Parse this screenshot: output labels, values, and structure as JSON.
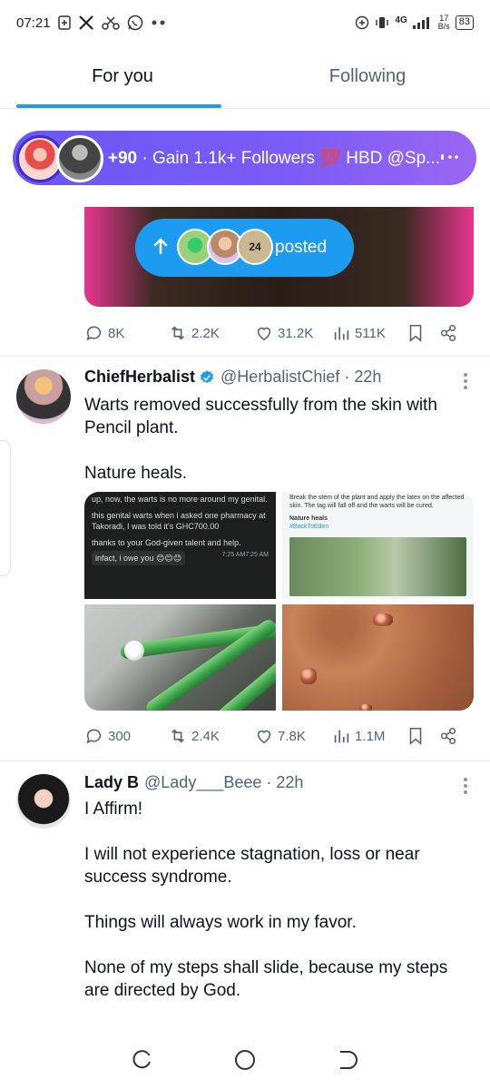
{
  "status_bar": {
    "time": "07:21",
    "network": "4G",
    "speed_value": "17",
    "speed_unit": "B/s",
    "battery": "83",
    "icons": [
      "add-box-icon",
      "x-logo-icon",
      "scissors-icon",
      "whatsapp-icon",
      "more-dots-icon",
      "data-saver-icon",
      "vibrate-icon",
      "signal-icon",
      "battery-icon"
    ]
  },
  "tabs": [
    {
      "label": "For you",
      "active": true
    },
    {
      "label": "Following",
      "active": false
    }
  ],
  "space_banner": {
    "count": "+90",
    "separator": " · ",
    "title": "Gain 1.1k+ Followers 💯 HBD @Sp...",
    "colors": {
      "start": "#6b56f5",
      "end": "#9a66f2"
    }
  },
  "posted_pill": {
    "badge": "24",
    "label": "posted"
  },
  "post_prev": {
    "replies": "8K",
    "retweets": "2.2K",
    "likes": "31.2K",
    "views": "511K"
  },
  "tweet_1": {
    "name": "ChiefHerbalist",
    "handle": "@HerbalistChief · 22h",
    "text": [
      "Warts removed successfully from the skin with Pencil plant.",
      "Nature heals."
    ],
    "media": {
      "chat": {
        "line1": "up, now, the warts is no more around my genital.",
        "line2": "this genital warts when i asked one pharmacy at Takoradi, I was told it's GHC700.00",
        "line3": "thanks to your God-given talent and help.",
        "time1": "7:25 AM",
        "bubble": "infact, i owe you 😊😊😊",
        "time2": "7:25 AM"
      },
      "info": {
        "caption": "Break the stem of the plant and apply the latex on the affected skin. The tag will fall off and the warts will be cured.",
        "heading": "Nature heals",
        "tag": "#BackToEden"
      }
    },
    "replies": "300",
    "retweets": "2.4K",
    "likes": "7.8K",
    "views": "1.1M"
  },
  "tweet_2": {
    "name": "Lady B",
    "handle": "@Lady___Beee · 22h",
    "text": [
      "I Affirm!",
      "I will not experience stagnation, loss or near success syndrome.",
      "Things will always work in my favor.",
      "None of my steps shall slide, because my steps are directed by God."
    ]
  },
  "accent": "#1d9bf0",
  "verified_color": "#1d9bf0"
}
